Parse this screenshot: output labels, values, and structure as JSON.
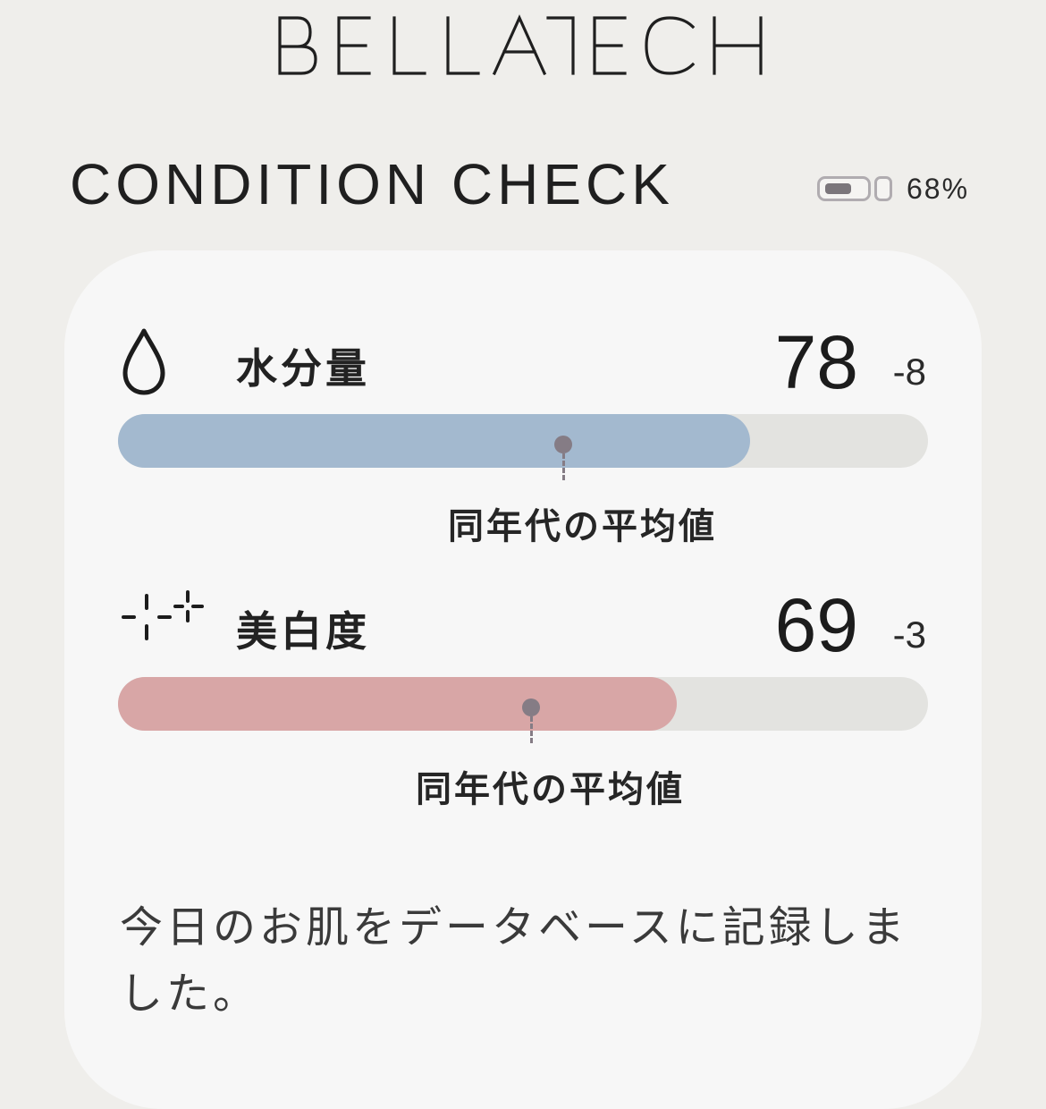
{
  "brand": {
    "name": "BELLATECH"
  },
  "header": {
    "title": "CONDITION CHECK",
    "battery_level": 0.68,
    "battery_label": "68%"
  },
  "metrics": [
    {
      "icon": "water-drop-icon",
      "label": "水分量",
      "value": "78",
      "delta": "-8",
      "level": 0.78,
      "average_level": 0.55,
      "average_label": "同年代の平均値",
      "color": "#a3b9cf"
    },
    {
      "icon": "sparkle-icon",
      "label": "美白度",
      "value": "69",
      "delta": "-3",
      "level": 0.69,
      "average_level": 0.51,
      "average_label": "同年代の平均値",
      "color": "#d8a6a6"
    }
  ],
  "footer": {
    "message": "今日のお肌をデータベースに記録しました。"
  }
}
